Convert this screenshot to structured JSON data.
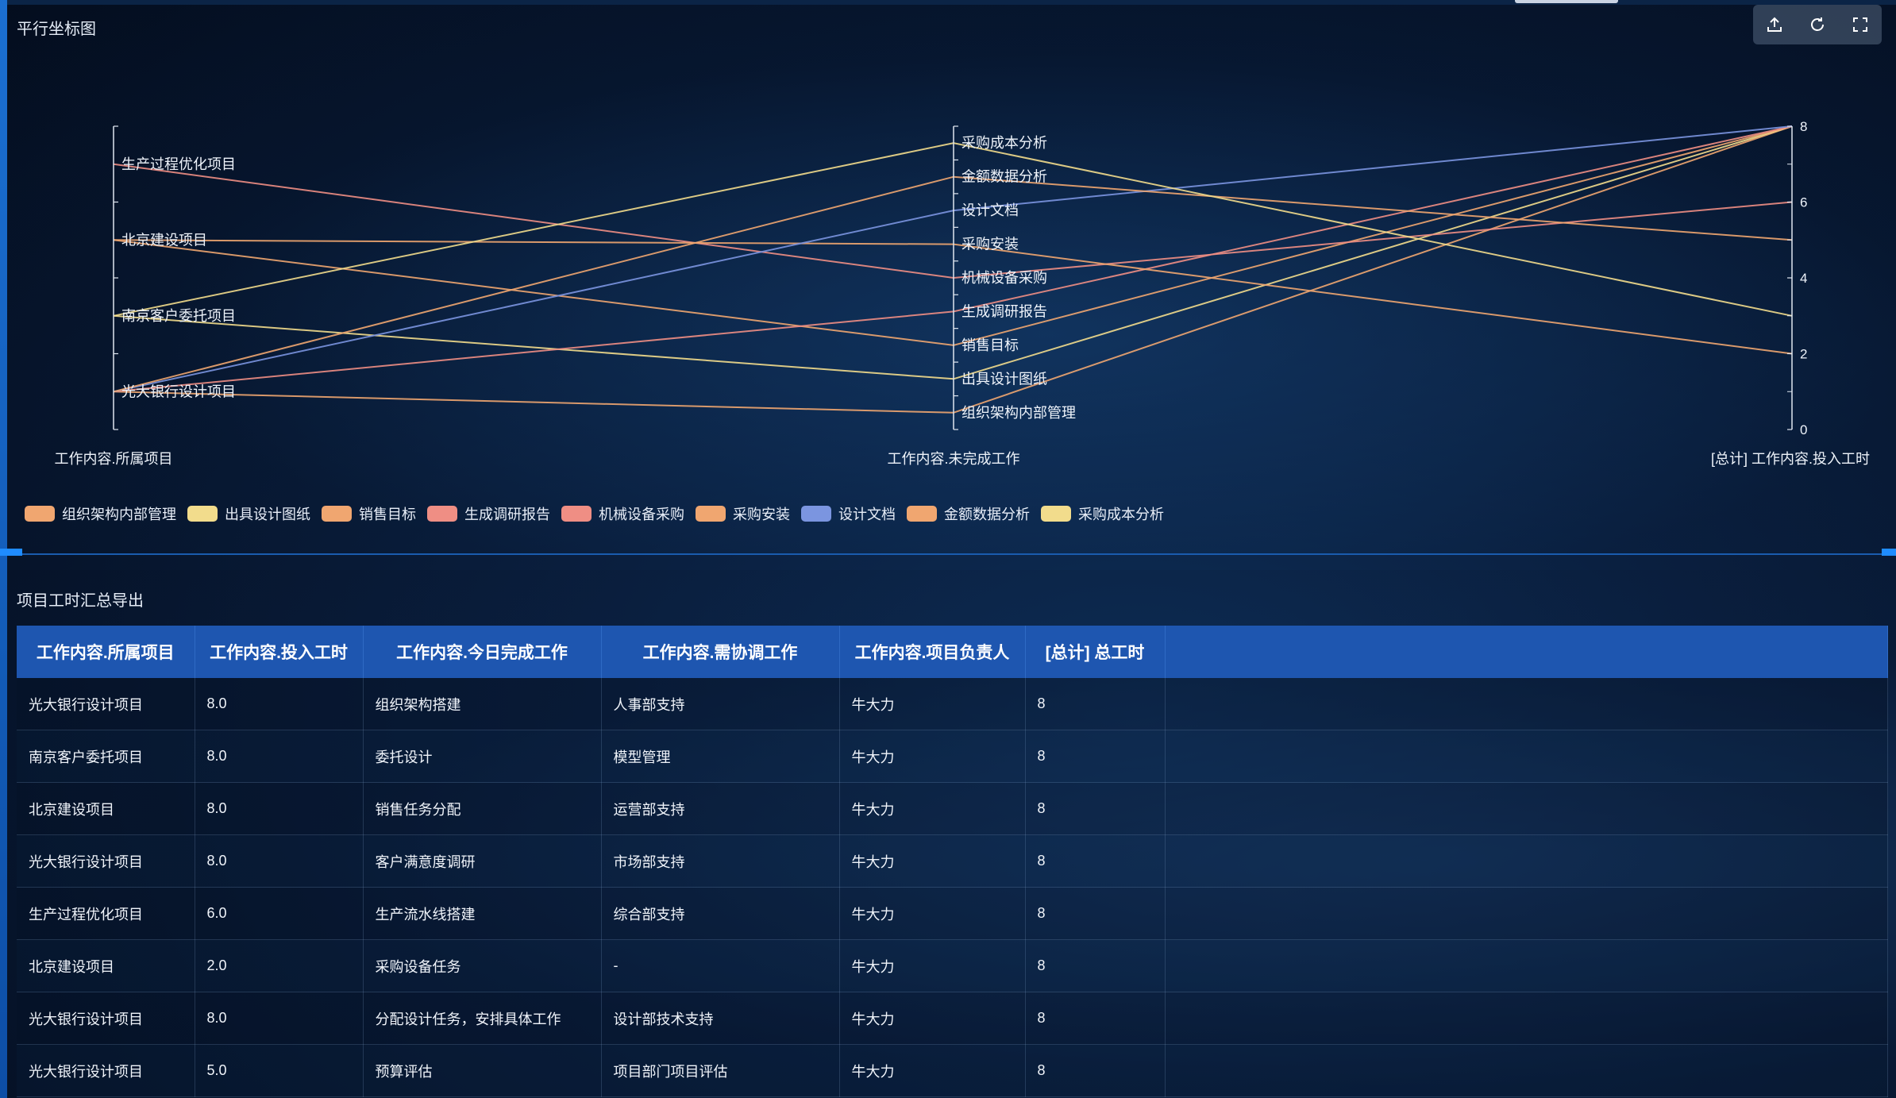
{
  "chart_panel": {
    "title": "平行坐标图",
    "toolbox": [
      "export-icon",
      "refresh-icon",
      "fullscreen-icon"
    ]
  },
  "chart_data": {
    "type": "parallel",
    "axes": [
      {
        "name": "工作内容.所属项目",
        "kind": "category",
        "categories": [
          "光大银行设计项目",
          "南京客户委托项目",
          "北京建设项目",
          "生产过程优化项目"
        ]
      },
      {
        "name": "工作内容.未完成工作",
        "kind": "category",
        "categories": [
          "组织架构内部管理",
          "出具设计图纸",
          "销售目标",
          "生成调研报告",
          "机械设备采购",
          "采购安装",
          "设计文档",
          "金额数据分析",
          "采购成本分析"
        ]
      },
      {
        "name": "[总计] 工作内容.投入工时",
        "kind": "value",
        "range": [
          0,
          8
        ],
        "ticks": [
          0,
          2,
          4,
          6,
          8
        ]
      }
    ],
    "series": [
      {
        "name": "组织架构内部管理",
        "color": "#f0a670",
        "values": [
          "光大银行设计项目",
          "组织架构内部管理",
          8
        ]
      },
      {
        "name": "出具设计图纸",
        "color": "#f2dc8c",
        "values": [
          "南京客户委托项目",
          "出具设计图纸",
          8
        ]
      },
      {
        "name": "销售目标",
        "color": "#f0a670",
        "values": [
          "北京建设项目",
          "销售目标",
          8
        ]
      },
      {
        "name": "生成调研报告",
        "color": "#ef8e84",
        "values": [
          "光大银行设计项目",
          "生成调研报告",
          8
        ]
      },
      {
        "name": "机械设备采购",
        "color": "#ef8e84",
        "values": [
          "生产过程优化项目",
          "机械设备采购",
          6
        ]
      },
      {
        "name": "采购安装",
        "color": "#f0a670",
        "values": [
          "北京建设项目",
          "采购安装",
          2
        ]
      },
      {
        "name": "设计文档",
        "color": "#7b95e0",
        "values": [
          "光大银行设计项目",
          "设计文档",
          8
        ]
      },
      {
        "name": "金额数据分析",
        "color": "#f0a670",
        "values": [
          "光大银行设计项目",
          "金额数据分析",
          5
        ]
      },
      {
        "name": "采购成本分析",
        "color": "#f2dc8c",
        "values": [
          "南京客户委托项目",
          "采购成本分析",
          3
        ]
      }
    ],
    "legend_position": "bottom-left"
  },
  "table_panel": {
    "title": "项目工时汇总导出",
    "columns": [
      "工作内容.所属项目",
      "工作内容.投入工时",
      "工作内容.今日完成工作",
      "工作内容.需协调工作",
      "工作内容.项目负责人",
      "[总计] 总工时"
    ],
    "rows": [
      [
        "光大银行设计项目",
        "8.0",
        "组织架构搭建",
        "人事部支持",
        "牛大力",
        "8"
      ],
      [
        "南京客户委托项目",
        "8.0",
        "委托设计",
        "模型管理",
        "牛大力",
        "8"
      ],
      [
        "北京建设项目",
        "8.0",
        "销售任务分配",
        "运营部支持",
        "牛大力",
        "8"
      ],
      [
        "光大银行设计项目",
        "8.0",
        "客户满意度调研",
        "市场部支持",
        "牛大力",
        "8"
      ],
      [
        "生产过程优化项目",
        "6.0",
        "生产流水线搭建",
        "综合部支持",
        "牛大力",
        "8"
      ],
      [
        "北京建设项目",
        "2.0",
        "采购设备任务",
        "-",
        "牛大力",
        "8"
      ],
      [
        "光大银行设计项目",
        "8.0",
        "分配设计任务，安排具体工作",
        "设计部技术支持",
        "牛大力",
        "8"
      ],
      [
        "光大银行设计项目",
        "5.0",
        "预算评估",
        "项目部门项目评估",
        "牛大力",
        "8"
      ]
    ]
  }
}
